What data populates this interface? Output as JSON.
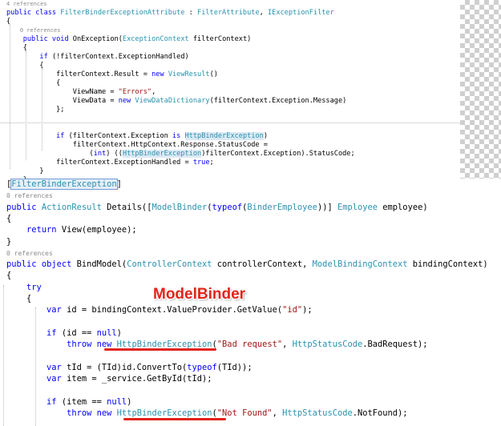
{
  "annotation": {
    "label": "ModelBinder",
    "color": "#e2231a"
  },
  "colors": {
    "keyword": "#0000ff",
    "type": "#2b91af",
    "string": "#a31515",
    "reference": "#8a8a8a"
  },
  "top_code": [
    [
      {
        "t": "4 references",
        "c": "ref"
      }
    ],
    [
      {
        "t": "public class ",
        "c": "kw:public class"
      },
      {
        "t": "FilterBinderExceptionAttribute",
        "c": "ty"
      },
      {
        "t": " : "
      },
      {
        "t": "FilterAttribute",
        "c": "ty"
      },
      {
        "t": ", "
      },
      {
        "t": "IExceptionFilter",
        "c": "ty"
      }
    ],
    [
      {
        "t": "{"
      }
    ],
    [
      {
        "t": "    0 references",
        "c": "ref"
      }
    ],
    [
      {
        "t": "    "
      },
      {
        "t": "public void",
        "c": "kw"
      },
      {
        "t": " OnException("
      },
      {
        "t": "ExceptionContext",
        "c": "ty"
      },
      {
        "t": " filterContext)"
      }
    ],
    [
      {
        "t": "    {"
      }
    ],
    [
      {
        "t": "        "
      },
      {
        "t": "if",
        "c": "kw"
      },
      {
        "t": " (!filterContext.ExceptionHandled)"
      }
    ],
    [
      {
        "t": "        {"
      }
    ],
    [
      {
        "t": "            filterContext.Result = "
      },
      {
        "t": "new",
        "c": "kw"
      },
      {
        "t": " "
      },
      {
        "t": "ViewResult",
        "c": "ty"
      },
      {
        "t": "()"
      }
    ],
    [
      {
        "t": "            {"
      }
    ],
    [
      {
        "t": "                ViewName = "
      },
      {
        "t": "\"Errors\"",
        "c": "st"
      },
      {
        "t": ","
      }
    ],
    [
      {
        "t": "                ViewData = "
      },
      {
        "t": "new",
        "c": "kw"
      },
      {
        "t": " "
      },
      {
        "t": "ViewDataDictionary",
        "c": "ty"
      },
      {
        "t": "(filterContext.Exception.Message)"
      }
    ],
    [
      {
        "t": "            };"
      }
    ],
    [
      {
        "t": ""
      }
    ],
    [
      {
        "t": ""
      }
    ],
    [
      {
        "t": "            "
      },
      {
        "t": "if",
        "c": "kw"
      },
      {
        "t": " (filterContext.Exception "
      },
      {
        "t": "is",
        "c": "kw"
      },
      {
        "t": " "
      },
      {
        "t": "HttpBinderException",
        "c": "ty hl"
      },
      {
        "t": ")"
      }
    ],
    [
      {
        "t": "                filterContext.HttpContext.Response.StatusCode ="
      }
    ],
    [
      {
        "t": "                    ("
      },
      {
        "t": "int",
        "c": "kw"
      },
      {
        "t": ") (("
      },
      {
        "t": "HttpBinderException",
        "c": "ty hl"
      },
      {
        "t": ")filterContext.Exception).StatusCode;"
      }
    ],
    [
      {
        "t": "            filterContext.ExceptionHandled = "
      },
      {
        "t": "true",
        "c": "kw"
      },
      {
        "t": ";"
      }
    ],
    [
      {
        "t": "        }"
      }
    ],
    [
      {
        "t": "    }"
      }
    ]
  ],
  "bottom_code": [
    [
      {
        "t": "["
      },
      {
        "t": "FilterBinderException",
        "c": "ty sel"
      },
      {
        "t": "]"
      }
    ],
    [
      {
        "t": "0 references",
        "c": "ref"
      }
    ],
    [
      {
        "t": "public",
        "c": "kw"
      },
      {
        "t": " "
      },
      {
        "t": "ActionResult",
        "c": "ty"
      },
      {
        "t": " Details(["
      },
      {
        "t": "ModelBinder",
        "c": "ty"
      },
      {
        "t": "("
      },
      {
        "t": "typeof",
        "c": "kw"
      },
      {
        "t": "("
      },
      {
        "t": "BinderEmployee",
        "c": "ty"
      },
      {
        "t": "))] "
      },
      {
        "t": "Employee",
        "c": "ty"
      },
      {
        "t": " employee)"
      }
    ],
    [
      {
        "t": "{"
      }
    ],
    [
      {
        "t": "    "
      },
      {
        "t": "return",
        "c": "kw"
      },
      {
        "t": " View(employee);"
      }
    ],
    [
      {
        "t": "}"
      }
    ],
    [
      {
        "t": "0 references",
        "c": "ref"
      }
    ],
    [
      {
        "t": "public",
        "c": "kw"
      },
      {
        "t": " "
      },
      {
        "t": "object",
        "c": "kw"
      },
      {
        "t": " BindModel("
      },
      {
        "t": "ControllerContext",
        "c": "ty"
      },
      {
        "t": " controllerContext, "
      },
      {
        "t": "ModelBindingContext",
        "c": "ty"
      },
      {
        "t": " bindingContext)"
      }
    ],
    [
      {
        "t": "{"
      }
    ],
    [
      {
        "t": "    "
      },
      {
        "t": "try",
        "c": "kw"
      }
    ],
    [
      {
        "t": "    {"
      }
    ],
    [
      {
        "t": "        "
      },
      {
        "t": "var",
        "c": "kw"
      },
      {
        "t": " id = bindingContext.ValueProvider.GetValue("
      },
      {
        "t": "\"id\"",
        "c": "st"
      },
      {
        "t": ");"
      }
    ],
    [
      {
        "t": ""
      }
    ],
    [
      {
        "t": "        "
      },
      {
        "t": "if",
        "c": "kw"
      },
      {
        "t": " (id == "
      },
      {
        "t": "null",
        "c": "kw"
      },
      {
        "t": ")"
      }
    ],
    [
      {
        "t": "            "
      },
      {
        "t": "throw",
        "c": "kw"
      },
      {
        "t": " "
      },
      {
        "t": "new",
        "c": "kw"
      },
      {
        "t": " "
      },
      {
        "t": "HttpBinderException",
        "c": "ty"
      },
      {
        "t": "("
      },
      {
        "t": "\"Bad request\"",
        "c": "st"
      },
      {
        "t": ", "
      },
      {
        "t": "HttpStatusCode",
        "c": "ty"
      },
      {
        "t": ".BadRequest);"
      }
    ],
    [
      {
        "t": ""
      }
    ],
    [
      {
        "t": "        "
      },
      {
        "t": "var",
        "c": "kw"
      },
      {
        "t": " tId = (TId)id.ConvertTo("
      },
      {
        "t": "typeof",
        "c": "kw"
      },
      {
        "t": "(TId));"
      }
    ],
    [
      {
        "t": "        "
      },
      {
        "t": "var",
        "c": "kw"
      },
      {
        "t": " item = _service.GetById(tId);"
      }
    ],
    [
      {
        "t": ""
      }
    ],
    [
      {
        "t": "        "
      },
      {
        "t": "if",
        "c": "kw"
      },
      {
        "t": " (item == "
      },
      {
        "t": "null",
        "c": "kw"
      },
      {
        "t": ")"
      }
    ],
    [
      {
        "t": "            "
      },
      {
        "t": "throw",
        "c": "kw"
      },
      {
        "t": " "
      },
      {
        "t": "new",
        "c": "kw"
      },
      {
        "t": " "
      },
      {
        "t": "HttpBinderException",
        "c": "ty"
      },
      {
        "t": "("
      },
      {
        "t": "\"Not Found\"",
        "c": "st"
      },
      {
        "t": ", "
      },
      {
        "t": "HttpStatusCode",
        "c": "ty"
      },
      {
        "t": ".NotFound);"
      }
    ]
  ]
}
